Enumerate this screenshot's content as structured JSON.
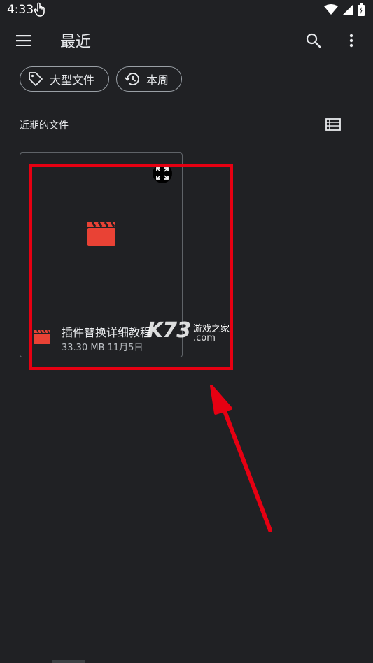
{
  "status_bar": {
    "time": "4:33"
  },
  "app_bar": {
    "title": "最近"
  },
  "chips": [
    {
      "label": "大型文件",
      "icon": "tag-icon"
    },
    {
      "label": "本周",
      "icon": "history-icon"
    }
  ],
  "section": {
    "title": "近期的文件"
  },
  "file": {
    "name": "插件替换详细教程",
    "size": "33.30 MB",
    "date": "11月5日",
    "icon": "video-clapper-icon"
  },
  "watermark": {
    "logo": "K73",
    "site": "游戏之家",
    "domain": ".com"
  },
  "colors": {
    "background": "#202124",
    "video_red": "#e94235",
    "annotation_red": "#e60012",
    "text": "#e8eaed"
  }
}
